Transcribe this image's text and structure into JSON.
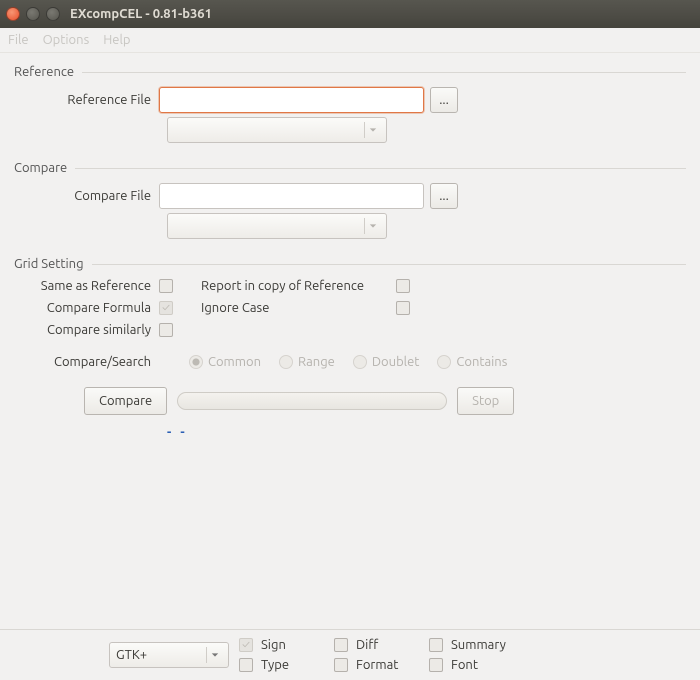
{
  "window": {
    "title": "EXcompCEL - 0.81-b361"
  },
  "menu": {
    "file": "File",
    "options": "Options",
    "help": "Help"
  },
  "reference": {
    "legend": "Reference",
    "file_label": "Reference File",
    "file_value": "",
    "browse": "..."
  },
  "compare": {
    "legend": "Compare",
    "file_label": "Compare File",
    "file_value": "",
    "browse": "..."
  },
  "grid": {
    "legend": "Grid Setting",
    "same_as_ref": "Same as Reference",
    "report_copy": "Report in copy of Reference",
    "compare_formula": "Compare Formula",
    "ignore_case": "Ignore Case",
    "compare_similarly": "Compare similarly",
    "compare_search": "Compare/Search",
    "radios": {
      "common": "Common",
      "range": "Range",
      "doublet": "Doublet",
      "contains": "Contains"
    }
  },
  "actions": {
    "compare": "Compare",
    "stop": "Stop"
  },
  "link_placeholder": "- -",
  "footer": {
    "theme": "GTK+",
    "sign": "Sign",
    "diff": "Diff",
    "summary": "Summary",
    "type": "Type",
    "format": "Format",
    "font": "Font"
  }
}
